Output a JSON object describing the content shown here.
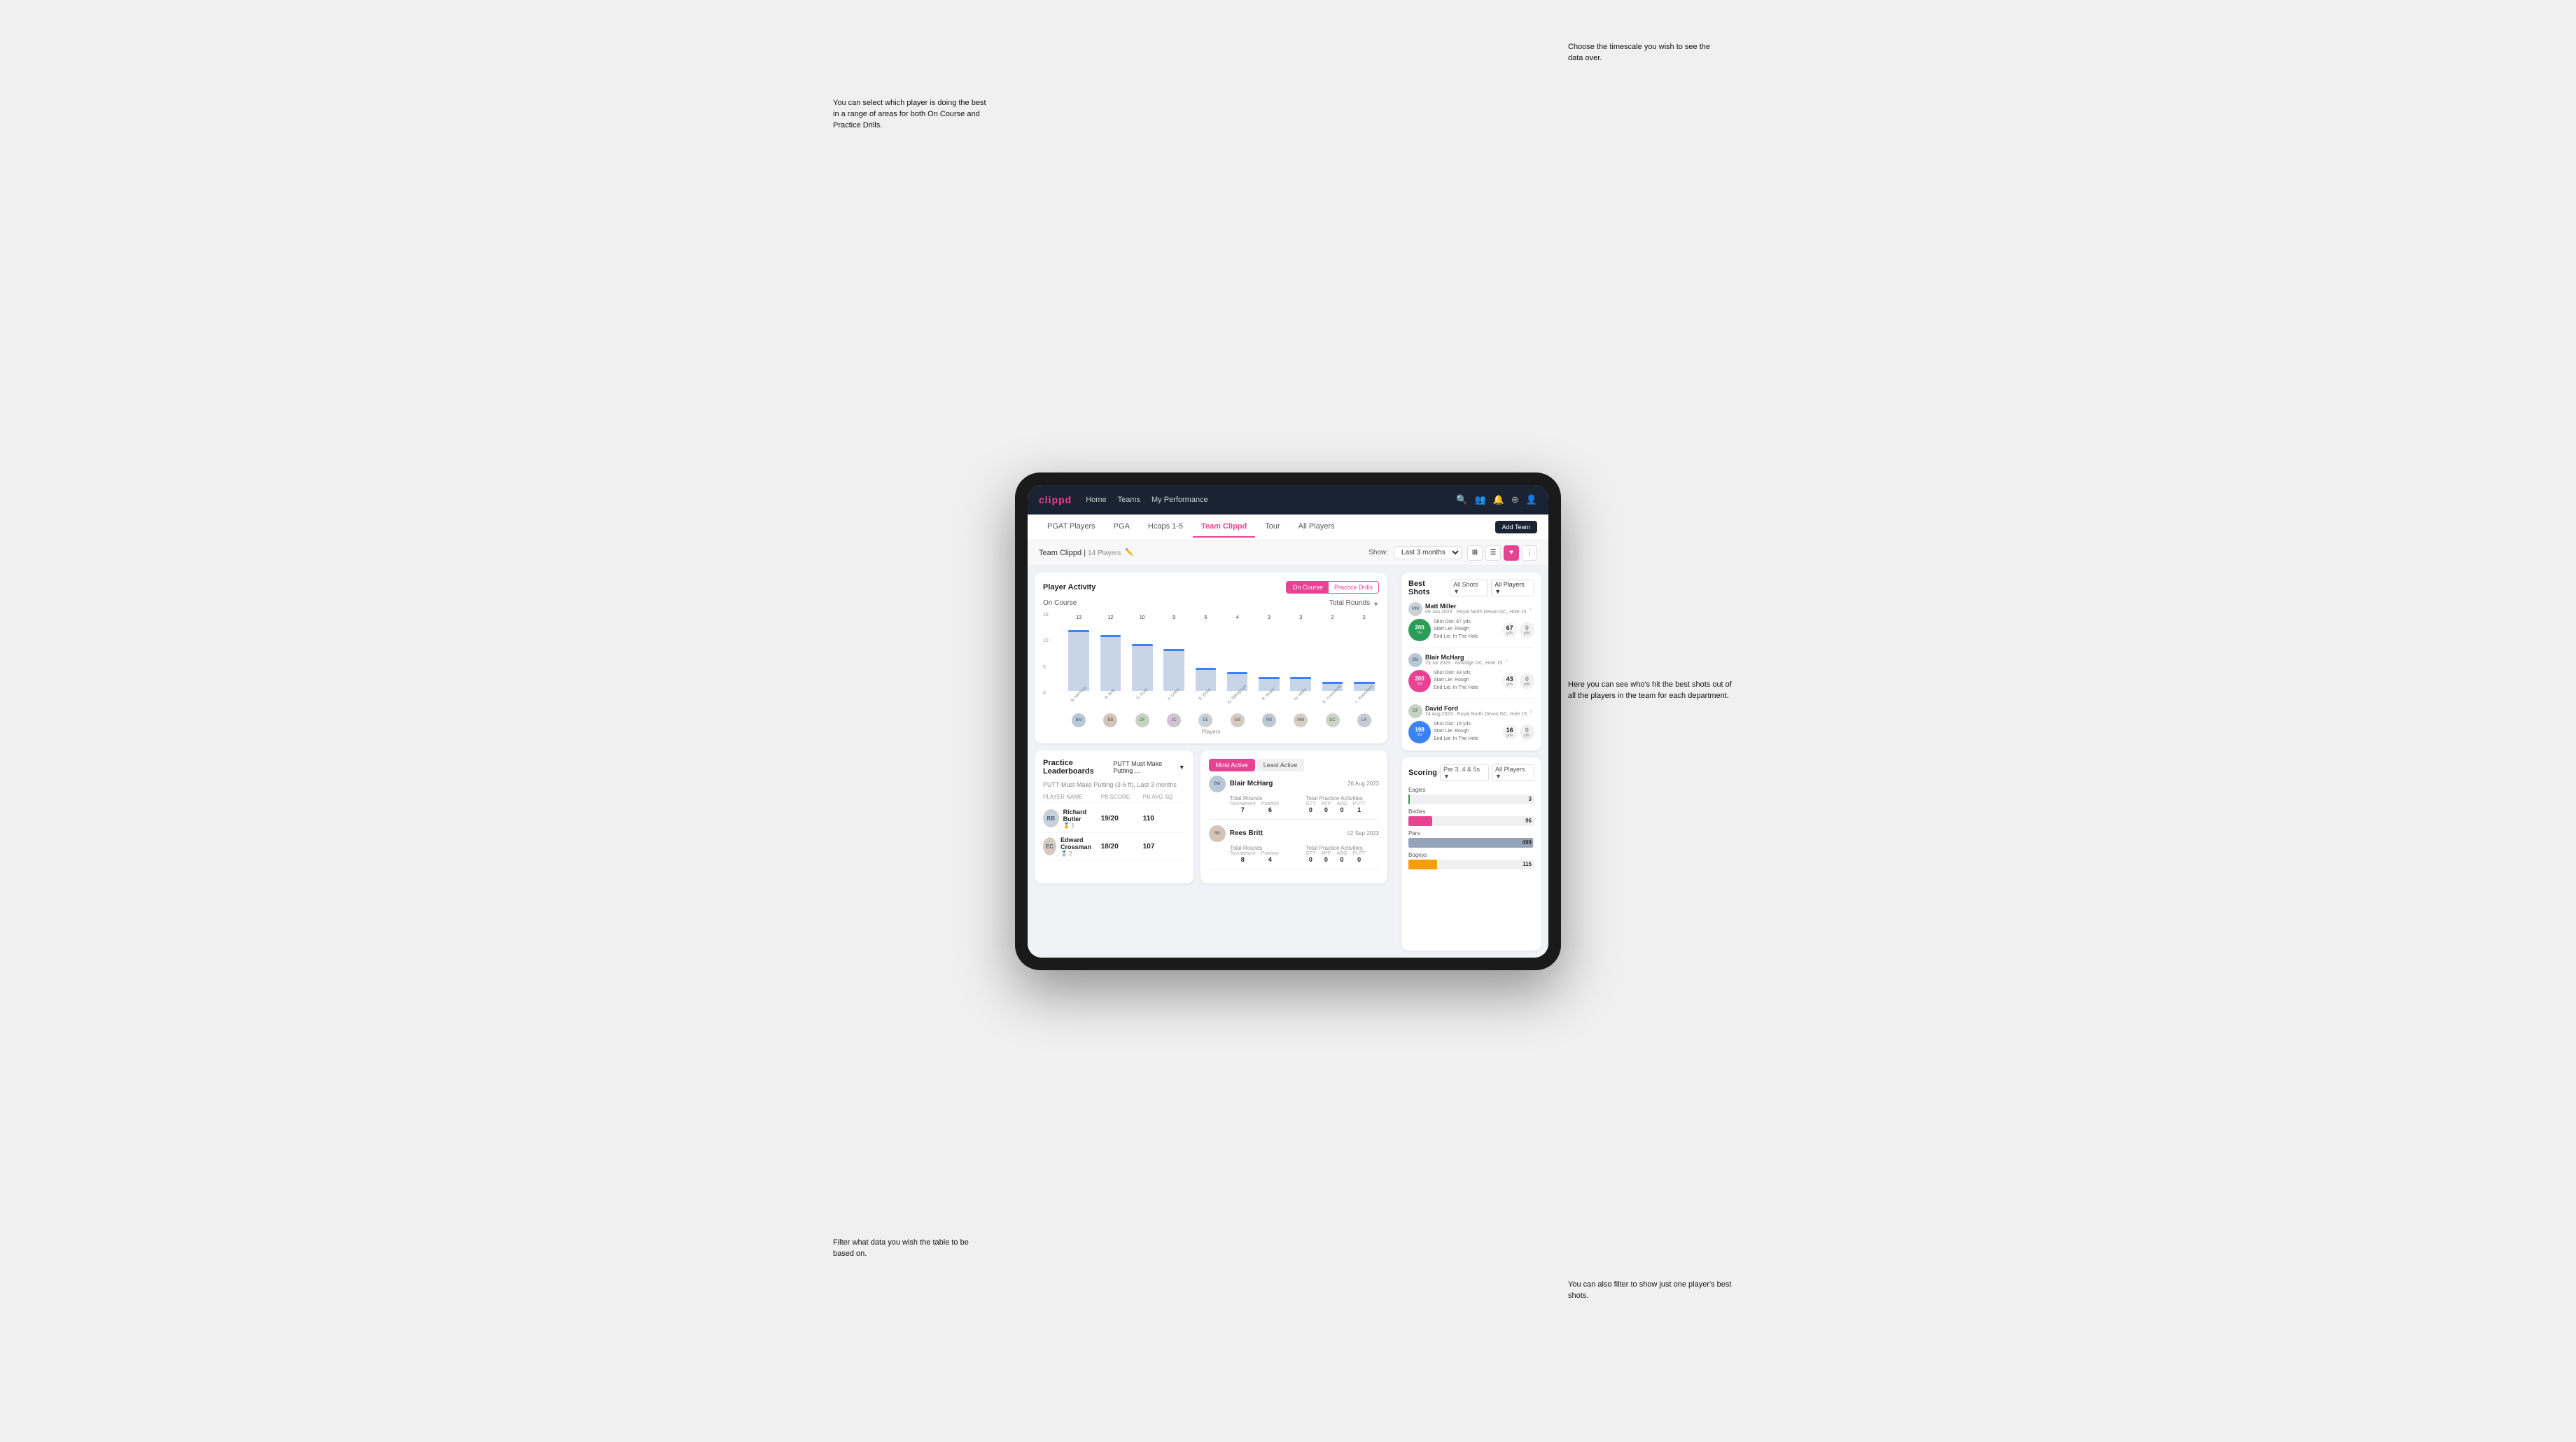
{
  "nav": {
    "logo": "clippd",
    "links": [
      "Home",
      "Teams",
      "My Performance"
    ],
    "icons": [
      "search",
      "people",
      "bell",
      "plus",
      "user"
    ]
  },
  "tabs": {
    "items": [
      "PGAT Players",
      "PGA",
      "Hcaps 1-5",
      "Team Clippd",
      "Tour",
      "All Players"
    ],
    "active": "Team Clippd",
    "add_button": "Add Team"
  },
  "subheader": {
    "team_name": "Team Clippd",
    "player_count": "14 Players",
    "show_label": "Show:",
    "time_select": "Last 3 months"
  },
  "player_activity": {
    "title": "Player Activity",
    "toggle_on": "On Course",
    "toggle_practice": "Practice Drills",
    "section_label": "On Course",
    "chart_dropdown": "Total Rounds",
    "x_label": "Players",
    "players": [
      {
        "name": "B. McHarg",
        "value": 13
      },
      {
        "name": "B. Britt",
        "value": 12
      },
      {
        "name": "D. Ford",
        "value": 10
      },
      {
        "name": "J. Coles",
        "value": 9
      },
      {
        "name": "E. Ebert",
        "value": 5
      },
      {
        "name": "G. Billingham",
        "value": 4
      },
      {
        "name": "R. Butler",
        "value": 3
      },
      {
        "name": "M. Miller",
        "value": 3
      },
      {
        "name": "E. Crossman",
        "value": 2
      },
      {
        "name": "L. Robertson",
        "value": 2
      }
    ]
  },
  "best_shots": {
    "title": "Best Shots",
    "filter_shots": "All Shots",
    "filter_players": "All Players",
    "players": [
      {
        "name": "Matt Miller",
        "date": "09 Jun 2023",
        "course": "Royal North Devon GC",
        "hole": "Hole 15",
        "badge_num": "200",
        "badge_sub": "SG",
        "shot_dist": "67 yds",
        "start_lie": "Rough",
        "end_lie": "In The Hole",
        "metric1_val": "67",
        "metric1_label": "yds",
        "metric2_val": "0",
        "metric2_label": "yds"
      },
      {
        "name": "Blair McHarg",
        "date": "23 Jul 2023",
        "course": "Ashridge GC",
        "hole": "Hole 15",
        "badge_num": "200",
        "badge_sub": "SG",
        "shot_dist": "43 yds",
        "start_lie": "Rough",
        "end_lie": "In The Hole",
        "metric1_val": "43",
        "metric1_label": "yds",
        "metric2_val": "0",
        "metric2_label": "yds"
      },
      {
        "name": "David Ford",
        "date": "24 Aug 2023",
        "course": "Royal North Devon GC",
        "hole": "Hole 15",
        "badge_num": "198",
        "badge_sub": "SG",
        "shot_dist": "16 yds",
        "start_lie": "Rough",
        "end_lie": "In The Hole",
        "metric1_val": "16",
        "metric1_label": "yds",
        "metric2_val": "0",
        "metric2_label": "yds"
      }
    ]
  },
  "scoring": {
    "title": "Scoring",
    "filter_par": "Par 3, 4 & 5s",
    "filter_players": "All Players",
    "bars": [
      {
        "label": "Eagles",
        "value": 3,
        "max": 500,
        "color": "#2a9d5a"
      },
      {
        "label": "Birdies",
        "value": 96,
        "max": 500,
        "color": "#e84393"
      },
      {
        "label": "Pars",
        "value": 499,
        "max": 500,
        "color": "#94a3b8"
      },
      {
        "label": "Bogeys",
        "value": 115,
        "max": 500,
        "color": "#f59e0b"
      }
    ]
  },
  "leaderboard": {
    "title": "Practice Leaderboards",
    "dropdown": "PUTT Must Make Putting ...",
    "subtitle": "PUTT Must Make Putting (3-6 ft), Last 3 months",
    "headers": [
      "PLAYER NAME",
      "PB SCORE",
      "PB AVG SQ"
    ],
    "rows": [
      {
        "name": "Richard Butler",
        "rank": 1,
        "score": "19/20",
        "avg": "110"
      },
      {
        "name": "Edward Crossman",
        "rank": 2,
        "score": "18/20",
        "avg": "107"
      }
    ]
  },
  "activity": {
    "title": "Most Active",
    "tab_most": "Most Active",
    "tab_least": "Least Active",
    "rows": [
      {
        "name": "Blair McHarg",
        "date": "26 Aug 2023",
        "total_rounds_label": "Total Rounds",
        "tournament": 7,
        "practice": 6,
        "total_practice_label": "Total Practice Activities",
        "gtt": 0,
        "app": 0,
        "arg": 0,
        "putt": 1
      },
      {
        "name": "Rees Britt",
        "date": "02 Sep 2023",
        "total_rounds_label": "Total Rounds",
        "tournament": 8,
        "practice": 4,
        "total_practice_label": "Total Practice Activities",
        "gtt": 0,
        "app": 0,
        "arg": 0,
        "putt": 0
      }
    ]
  },
  "annotations": {
    "top_right": "Choose the timescale you\nwish to see the data over.",
    "top_left": "You can select which player is\ndoing the best in a range of\nareas for both On Course and\nPractice Drills.",
    "bottom_left": "Filter what data you wish the\ntable to be based on.",
    "bottom_right_top": "Here you can see who's hit\nthe best shots out of all the\nplayers in the team for\neach department.",
    "bottom_right_bottom": "You can also filter to show\njust one player's best shots."
  }
}
